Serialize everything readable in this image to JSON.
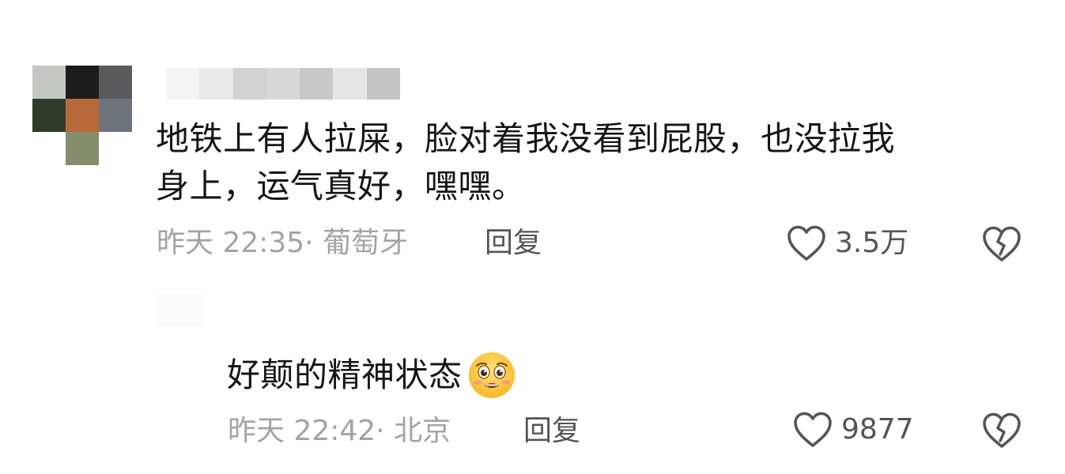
{
  "colors": {
    "text_primary": "#161616",
    "text_meta": "#a3a3a3",
    "action": "#555555",
    "background": "#ffffff"
  },
  "comment": {
    "avatar_icon": "pixelated-avatar",
    "text_line1": "地铁上有人拉屎，脸对着我没看到屁股，也没拉我",
    "text_line2": "身上，运气真好，嘿嘿。",
    "meta": "昨天 22:35· 葡萄牙",
    "reply_label": "回复",
    "likes": "3.5万",
    "like_icon": "heart-outline-icon",
    "dislike_icon": "broken-heart-icon"
  },
  "reply": {
    "text": "好颠的精神状态",
    "emoji": "pleading-face-emoji",
    "meta": "昨天 22:42· 北京",
    "reply_label": "回复",
    "likes": "9877",
    "like_icon": "heart-outline-icon",
    "dislike_icon": "broken-heart-icon"
  }
}
